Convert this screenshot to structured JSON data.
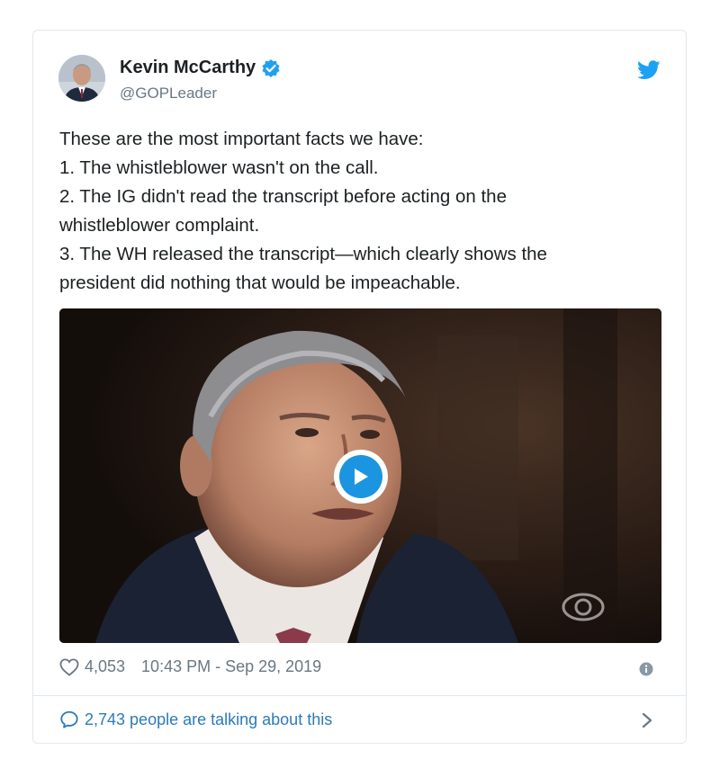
{
  "tweet": {
    "author_name": "Kevin McCarthy",
    "handle": "@GOPLeader",
    "text_lines": [
      "These are the most important facts we have:",
      "1. The whistleblower wasn't on the call.",
      "2. The IG didn't read the transcript before acting on the",
      "whistleblower complaint.",
      "3. The WH released the transcript—which clearly shows the",
      "president did nothing that would be impeachable."
    ],
    "likes": "4,053",
    "timestamp": "10:43 PM - Sep 29, 2019",
    "talking": "2,743 people are talking about this"
  },
  "colors": {
    "accent": "#1da1f2",
    "link": "#2b7bb9",
    "meta": "#697882",
    "border": "#e1e8ed"
  },
  "icons": {
    "verified": "verified-badge-icon",
    "platform": "twitter-bird-icon",
    "like": "heart-icon",
    "reply": "speech-bubble-icon",
    "info": "info-icon",
    "play": "play-icon",
    "more": "chevron-right-icon"
  }
}
